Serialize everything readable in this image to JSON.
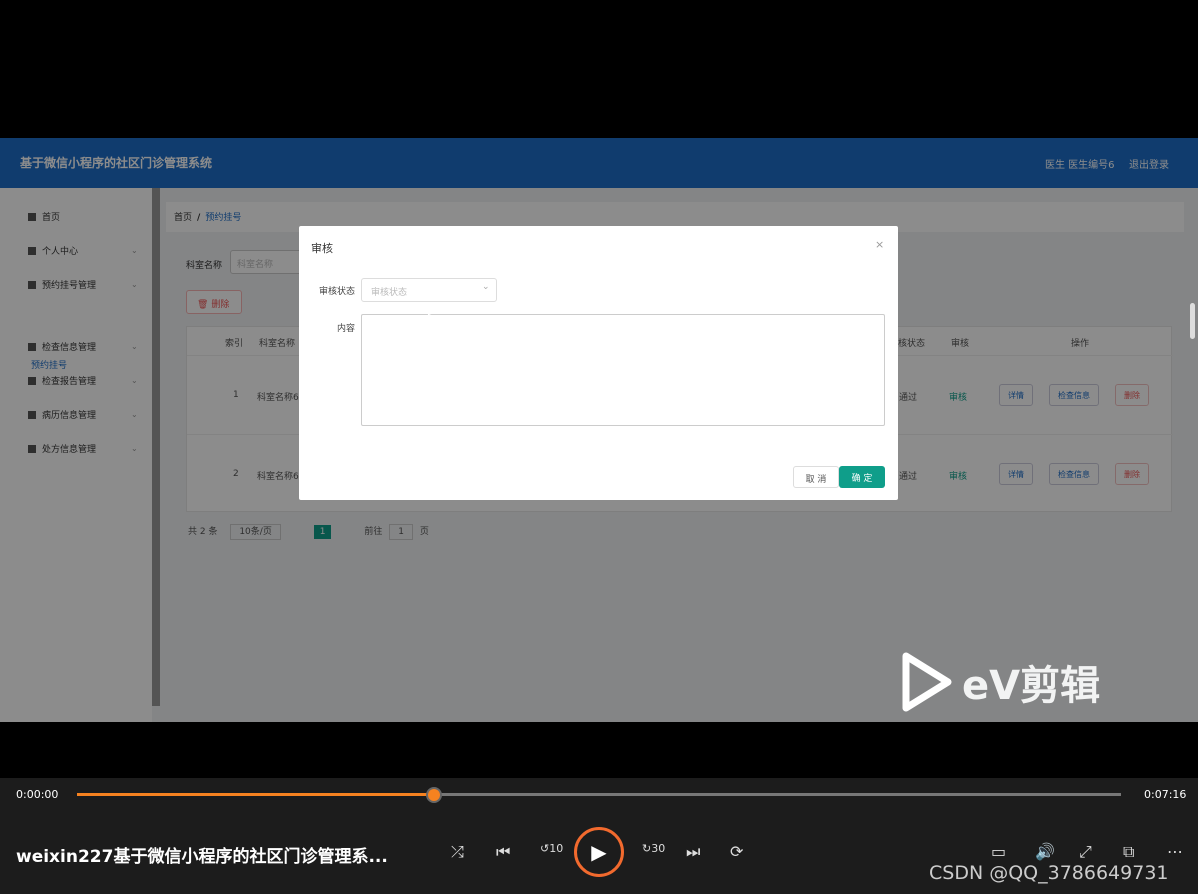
{
  "app": {
    "title": "基于微信小程序的社区门诊管理系统",
    "user_label": "医生 医生编号6",
    "logout_label": "退出登录"
  },
  "sidebar": {
    "items": [
      {
        "label": "首页",
        "icon": "home-icon"
      },
      {
        "label": "个人中心",
        "icon": "user-icon"
      },
      {
        "label": "预约挂号管理",
        "icon": "grid-icon"
      },
      {
        "label": "检查信息管理",
        "icon": "grid-icon"
      },
      {
        "label": "检查报告管理",
        "icon": "briefcase-icon"
      },
      {
        "label": "病历信息管理",
        "icon": "doc-icon"
      },
      {
        "label": "处方信息管理",
        "icon": "send-icon"
      }
    ],
    "active_sub": "预约挂号"
  },
  "breadcrumb": {
    "home": "首页",
    "current": "预约挂号"
  },
  "filter": {
    "label": "科室名称",
    "placeholder": "科室名称"
  },
  "toolbar": {
    "delete_label": "删除"
  },
  "table": {
    "headers": [
      "索引",
      "科室名称",
      "审核状态",
      "审核",
      "操作"
    ],
    "rows": [
      {
        "index": "1",
        "dept": "科室名称6",
        "status": "通过",
        "audit": "审核"
      },
      {
        "index": "2",
        "dept": "科室名称6",
        "status": "通过",
        "audit": "审核"
      }
    ],
    "actions": {
      "detail": "详情",
      "check": "检查信息",
      "delete": "删除"
    }
  },
  "pager": {
    "total": "共 2 条",
    "page_size": "10条/页",
    "current_page": "1",
    "goto": "前往",
    "goto_value": "1",
    "page_unit": "页"
  },
  "dialog": {
    "title": "审核",
    "status_label": "审核状态",
    "status_placeholder": "审核状态",
    "content_label": "内容",
    "cancel_label": "取 消",
    "ok_label": "确 定"
  },
  "watermark": {
    "text": "eV剪辑"
  },
  "player": {
    "time_current": "0:00:00",
    "time_total": "0:07:16",
    "progress": 0.342,
    "video_title": "weixin227基于微信小程序的社区门诊管理系...",
    "csdn": "CSDN @QQ_3786649731",
    "skip_back": "10",
    "skip_forward": "30"
  },
  "colors": {
    "brand": "#1e6ec8",
    "accent": "#f58220",
    "ok": "#0f9e8a"
  }
}
